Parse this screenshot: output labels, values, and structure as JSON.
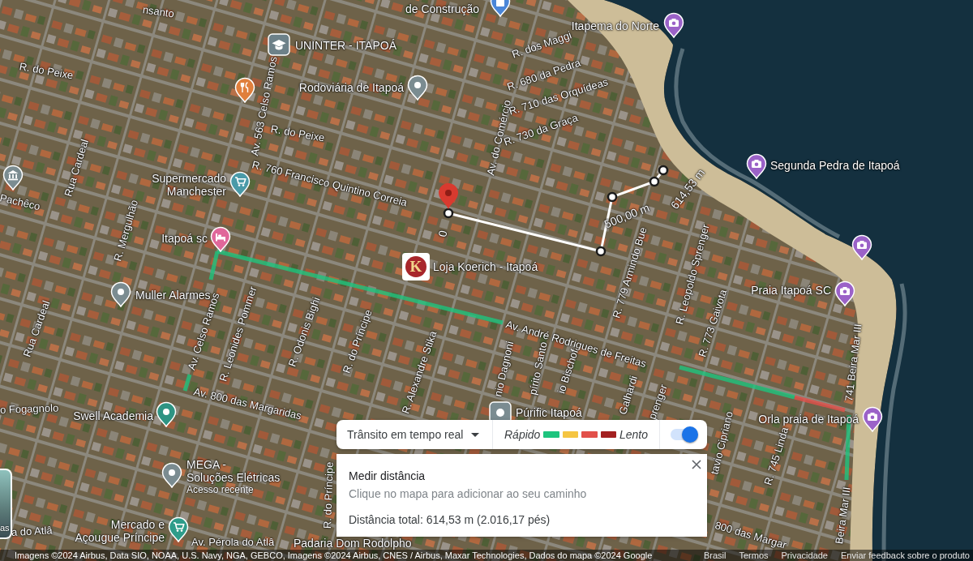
{
  "map": {
    "places": [
      {
        "kind": "pin",
        "color": "#4a86d8",
        "lines": [
          "de Construção"
        ]
      },
      {
        "kind": "square",
        "color": "#6d8189",
        "lines": [
          "UNINTER - ITAPOÁ"
        ]
      },
      {
        "kind": "pin",
        "color": "#7b8c91",
        "lines": [
          "Rodoviária de Itapoá"
        ]
      },
      {
        "kind": "pin",
        "color": "#e07f3c"
      },
      {
        "kind": "pin",
        "color": "#4a9aa8",
        "lines": [
          "Supermercado",
          "Manchester"
        ]
      },
      {
        "kind": "pin",
        "color": "#e0679a",
        "lines": [
          "Itapoá sc"
        ]
      },
      {
        "kind": "pin",
        "color": "#7b8c91"
      },
      {
        "kind": "pin",
        "color": "#7b8c91",
        "lines": [
          "Muller Alarmes"
        ]
      },
      {
        "kind": "pin",
        "color": "#2e9483",
        "lines": [
          "Swell Academia"
        ]
      },
      {
        "kind": "pin",
        "color": "#7b8c91",
        "lines": [
          "MEGA -",
          "Soluções Elétricas"
        ],
        "note": "Acesso recente"
      },
      {
        "kind": "pin",
        "color": "#2e9c8a",
        "lines": [
          "Mercado e",
          "Açougue Príncipe"
        ]
      },
      {
        "kind": "logo",
        "color": "#a8262b",
        "logo_letter": "K",
        "lines": [
          "Loja Koerich - Itapoá"
        ]
      },
      {
        "kind": "square",
        "color": "#7b8c91",
        "lines": [
          "Púrific Itapoá"
        ]
      },
      {
        "kind": "pin",
        "color": "#9b62c8",
        "lines": [
          "Itapema do Norte"
        ]
      },
      {
        "kind": "pin",
        "color": "#9b62c8",
        "lines": [
          "Segunda Pedra de Itapoá"
        ]
      },
      {
        "kind": "pin",
        "color": "#9b62c8"
      },
      {
        "kind": "pin",
        "color": "#9b62c8",
        "lines": [
          "Praia Itapoá SC"
        ]
      },
      {
        "kind": "pin",
        "color": "#9b62c8",
        "lines": [
          "Orla praia de Itapoá"
        ]
      },
      {
        "kind": "label",
        "lines": [
          "Padaria Dom Rodolpho"
        ]
      }
    ],
    "streets": [
      "nsanto",
      "R. do Peixe",
      "Av. 563 Celso Ramos",
      "R. do Peixe",
      "Rua Cardeal",
      "Pachêco",
      "R. 760 Francisco Quintino Correia",
      "R. Mergulhão",
      "Rua Cardeal",
      "Av. Celso Ramos",
      "R. Leonides Pommer",
      "R. Odonis Bighi",
      "R. do Príncipe",
      "R. Alexandre Stika",
      "Av. 800 das Margaridas",
      "o Fogagnolo",
      "R. do Príncipe",
      "a do Atlâ",
      "Av. Pérola do Atlâ",
      "Av. do Comércio",
      "R. dos Maggi",
      "R. 680 da Pedra",
      "R. 710 das Orquídeas",
      "R. 730 da Graça",
      "R. 779 Armindo Bue",
      "R. Leopoldo Sprenger",
      "R. 773 Gaivota",
      "Av. André Rodrigues de Freitas",
      "nio Dagnoni",
      "pírito Santo",
      "io Bischof",
      "Galhardi",
      "prenger",
      "tavio Cipriano",
      "R. 745 Linda",
      "741 Beira Mar III",
      "Beira Mar III",
      "800 das Margar"
    ]
  },
  "measurement": {
    "labels": [
      "0",
      "500,00 m",
      "614,53 m"
    ]
  },
  "layers_button": {
    "label": "as"
  },
  "traffic_panel": {
    "mode": "Trânsito em tempo real",
    "fast_label": "Rápido",
    "slow_label": "Lento",
    "legend": [
      {
        "color": "#1ec47e"
      },
      {
        "color": "#f5c542"
      },
      {
        "color": "#e2504a"
      },
      {
        "color": "#a32020"
      }
    ],
    "on": true
  },
  "measure_card": {
    "title": "Medir distância",
    "hint": "Clique no mapa para adicionar ao seu caminho",
    "total": "Distância total: 614,53 m (2.016,17 pés)"
  },
  "footer": {
    "attribution": "Imagens ©2024 Airbus, Data SIO, NOAA, U.S. Navy, NGA, GEBCO, Imagens ©2024 Airbus, CNES / Airbus, Maxar Technologies, Dados do mapa ©2024 Google",
    "links": [
      "Brasil",
      "Termos",
      "Privacidade",
      "Enviar feedback sobre o produto"
    ]
  }
}
